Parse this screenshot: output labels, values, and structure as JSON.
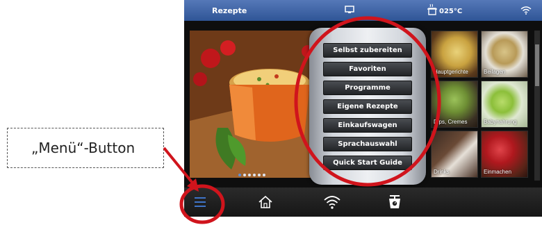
{
  "status_bar": {
    "title": "Rezepte",
    "temperature": "025°C",
    "icons": [
      "display-icon",
      "pot-icon",
      "wifi-icon"
    ]
  },
  "menu": {
    "items": [
      "Selbst zubereiten",
      "Favoriten",
      "Programme",
      "Eigene Rezepte",
      "Einkaufswagen",
      "Sprachauswahl",
      "Quick Start Guide"
    ]
  },
  "categories": [
    "Hauptgerichte",
    "Beilagen",
    "Dips, Cremes",
    "Babynahrung",
    "Drinks",
    "Einmachen"
  ],
  "carousel": {
    "page_count": 6,
    "active_index": 0
  },
  "nav": {
    "buttons": [
      "menu-icon",
      "home-icon",
      "wifi-icon",
      "scale-icon"
    ],
    "active": "menu-icon"
  },
  "annotation": {
    "label": "„Menü“-Button",
    "highlight_color": "#d0141c"
  },
  "colors": {
    "status_bar": "#2f5596",
    "accent_blue": "#3f74c8",
    "menu_button": "#2a2c30"
  }
}
